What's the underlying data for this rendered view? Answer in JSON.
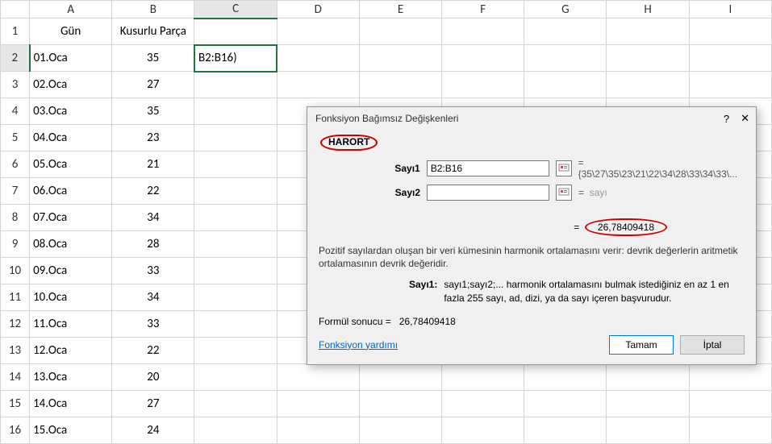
{
  "columns": [
    "A",
    "B",
    "C",
    "D",
    "E",
    "F",
    "G",
    "H",
    "I"
  ],
  "headerRow": {
    "a": "Gün",
    "b": "Kusurlu Parça"
  },
  "rows": [
    {
      "n": "1"
    },
    {
      "n": "2",
      "a": "01.Oca",
      "b": "35",
      "c": "B2:B16)"
    },
    {
      "n": "3",
      "a": "02.Oca",
      "b": "27"
    },
    {
      "n": "4",
      "a": "03.Oca",
      "b": "35"
    },
    {
      "n": "5",
      "a": "04.Oca",
      "b": "23"
    },
    {
      "n": "6",
      "a": "05.Oca",
      "b": "21"
    },
    {
      "n": "7",
      "a": "06.Oca",
      "b": "22"
    },
    {
      "n": "8",
      "a": "07.Oca",
      "b": "34"
    },
    {
      "n": "9",
      "a": "08.Oca",
      "b": "28"
    },
    {
      "n": "10",
      "a": "09.Oca",
      "b": "33"
    },
    {
      "n": "11",
      "a": "10.Oca",
      "b": "34"
    },
    {
      "n": "12",
      "a": "11.Oca",
      "b": "33"
    },
    {
      "n": "13",
      "a": "12.Oca",
      "b": "22"
    },
    {
      "n": "14",
      "a": "13.Oca",
      "b": "20"
    },
    {
      "n": "15",
      "a": "14.Oca",
      "b": "27"
    },
    {
      "n": "16",
      "a": "15.Oca",
      "b": "24"
    }
  ],
  "dialog": {
    "title": "Fonksiyon Bağımsız Değişkenleri",
    "help_char": "?",
    "close_char": "✕",
    "fn_name": "HARORT",
    "arg1": {
      "label": "Sayı1",
      "value": "B2:B16",
      "preview": "= {35\\27\\35\\23\\21\\22\\34\\28\\33\\34\\33\\..."
    },
    "arg2": {
      "label": "Sayı2",
      "value": "",
      "preview_eq": "=",
      "preview": "sayı"
    },
    "result_eq": "=",
    "result": "26,78409418",
    "description": "Pozitif sayılardan oluşan bir veri kümesinin harmonik ortalamasını verir: devrik değerlerin aritmetik ortalamasının devrik değeridir.",
    "arg_help_label": "Sayı1:",
    "arg_help_text": "sayı1;sayı2;... harmonik ortalamasını bulmak istediğiniz en az 1 en fazla 255 sayı, ad, dizi, ya da sayı içeren başvurudur.",
    "formula_result_label": "Formül sonucu =",
    "formula_result_value": "26,78409418",
    "help_link": "Fonksiyon yardımı",
    "ok": "Tamam",
    "cancel": "İptal"
  },
  "selected": {
    "col": "C",
    "row": "2"
  }
}
